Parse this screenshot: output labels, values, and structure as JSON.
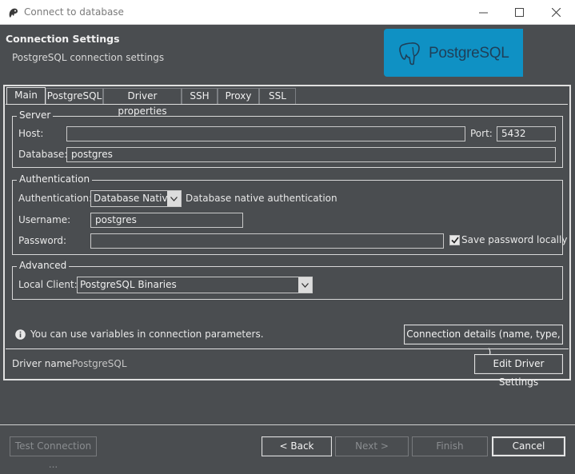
{
  "window": {
    "title": "Connect to database"
  },
  "header": {
    "title": "Connection Settings",
    "subtitle": "PostgreSQL connection settings",
    "logo_text": "PostgreSQL"
  },
  "tabs": [
    "Main",
    "PostgreSQL",
    "Driver properties",
    "SSH",
    "Proxy",
    "SSL"
  ],
  "server": {
    "legend": "Server",
    "host_label": "Host:",
    "host_value": "",
    "port_label": "Port:",
    "port_value": "5432",
    "database_label": "Database:",
    "database_value": "postgres"
  },
  "auth": {
    "legend": "Authentication",
    "auth_label": "Authentication:",
    "auth_value": "Database Native",
    "auth_desc": "Database native authentication",
    "username_label": "Username:",
    "username_value": "postgres",
    "password_label": "Password:",
    "password_value": "",
    "save_password_label": "Save password locally",
    "save_password_checked": true
  },
  "advanced": {
    "legend": "Advanced",
    "local_client_label": "Local Client:",
    "local_client_value": "PostgreSQL Binaries"
  },
  "info": {
    "text": "You can use variables in connection parameters.",
    "details_button": "Connection details (name, type, ... )"
  },
  "driver": {
    "label": "Driver name:",
    "value": "PostgreSQL",
    "settings_button": "Edit Driver Settings"
  },
  "footer": {
    "test_button": "Test Connection ...",
    "back_button": "< Back",
    "next_button": "Next >",
    "finish_button": "Finish",
    "cancel_button": "Cancel"
  },
  "colors": {
    "background": "#4a4d50",
    "logo_background": "#0f91c4",
    "logo_text": "#1f3f58"
  }
}
